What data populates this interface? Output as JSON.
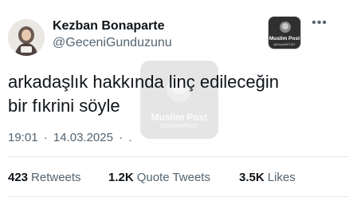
{
  "author": {
    "display_name": "Kezban Bonaparte",
    "handle": "@GeceniGunduzunu"
  },
  "brand_badge": {
    "title": "Muslim Post",
    "subtitle": "@MuslimPOST"
  },
  "watermark": {
    "title": "Muslim Post",
    "subtitle": "@MuslimPOST"
  },
  "more_label": "•••",
  "tweet": {
    "line1": "arkadaşlık hakkında linç edileceğin",
    "line2": "bir fıkrini söyle"
  },
  "timestamp": {
    "time": "19:01",
    "sep1": "·",
    "date": "14.03.2025",
    "sep2": "·",
    "trail": "."
  },
  "stats": {
    "retweets": {
      "count": "423",
      "label": "Retweets"
    },
    "quotes": {
      "count": "1.2K",
      "label": "Quote Tweets"
    },
    "likes": {
      "count": "3.5K",
      "label": "Likes"
    }
  },
  "colors": {
    "text": "#0f1419",
    "muted": "#536471",
    "divider": "#e1e8ed"
  }
}
